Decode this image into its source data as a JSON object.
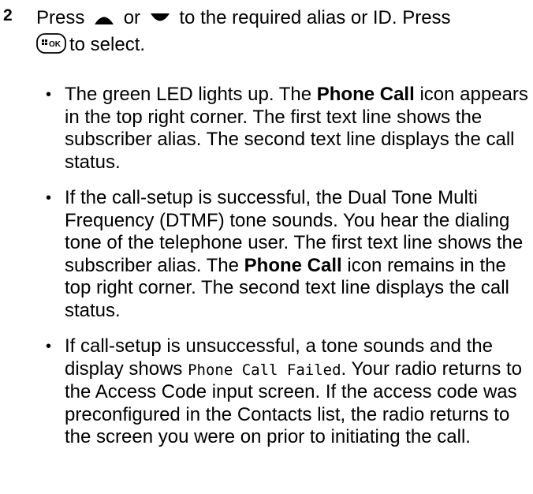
{
  "step": {
    "number": "2",
    "line1_a": "Press",
    "line1_b": "or",
    "line1_c": "to the required alias or ID. Press",
    "line2": "to select.",
    "icons": [
      "up-arrow-icon",
      "down-arrow-icon",
      "menu-ok-key-icon"
    ]
  },
  "bullets": [
    {
      "p1": "The green LED lights up. The ",
      "b1": "Phone Call",
      "p2": " icon appears in the top right corner. The first text line shows the subscriber alias. The second text line displays the call status."
    },
    {
      "p1": "If the call-setup is successful, the Dual Tone Multi Frequency (DTMF) tone sounds. You hear the dialing tone of the telephone user. The first text line shows the subscriber alias. The ",
      "b1": "Phone Call",
      "p2": " icon remains in the top right corner. The second text line displays the call status."
    },
    {
      "p1": "If call-setup is unsuccessful, a tone sounds and the display shows ",
      "mono": "Phone Call Failed",
      "p2": ". Your radio returns to the Access Code input screen. If the access code was preconfigured in the Contacts list, the radio returns to the screen you were on prior to initiating the call."
    }
  ],
  "bullet_glyph": "•"
}
